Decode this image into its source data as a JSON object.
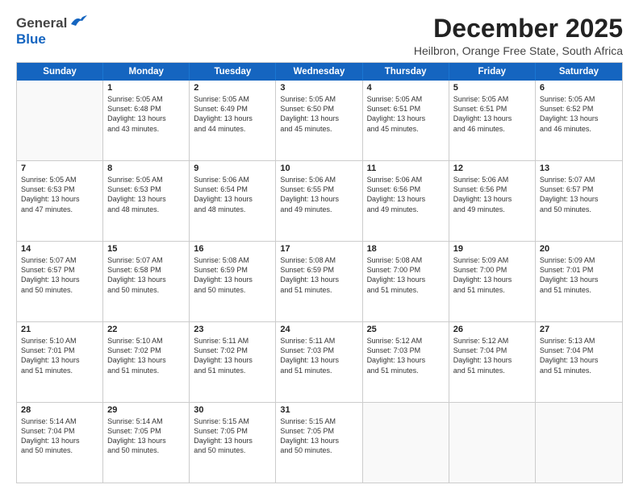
{
  "header": {
    "logo_general": "General",
    "logo_blue": "Blue",
    "month": "December 2025",
    "location": "Heilbron, Orange Free State, South Africa"
  },
  "weekdays": [
    "Sunday",
    "Monday",
    "Tuesday",
    "Wednesday",
    "Thursday",
    "Friday",
    "Saturday"
  ],
  "rows": [
    [
      {
        "day": "",
        "lines": []
      },
      {
        "day": "1",
        "lines": [
          "Sunrise: 5:05 AM",
          "Sunset: 6:48 PM",
          "Daylight: 13 hours",
          "and 43 minutes."
        ]
      },
      {
        "day": "2",
        "lines": [
          "Sunrise: 5:05 AM",
          "Sunset: 6:49 PM",
          "Daylight: 13 hours",
          "and 44 minutes."
        ]
      },
      {
        "day": "3",
        "lines": [
          "Sunrise: 5:05 AM",
          "Sunset: 6:50 PM",
          "Daylight: 13 hours",
          "and 45 minutes."
        ]
      },
      {
        "day": "4",
        "lines": [
          "Sunrise: 5:05 AM",
          "Sunset: 6:51 PM",
          "Daylight: 13 hours",
          "and 45 minutes."
        ]
      },
      {
        "day": "5",
        "lines": [
          "Sunrise: 5:05 AM",
          "Sunset: 6:51 PM",
          "Daylight: 13 hours",
          "and 46 minutes."
        ]
      },
      {
        "day": "6",
        "lines": [
          "Sunrise: 5:05 AM",
          "Sunset: 6:52 PM",
          "Daylight: 13 hours",
          "and 46 minutes."
        ]
      }
    ],
    [
      {
        "day": "7",
        "lines": [
          "Sunrise: 5:05 AM",
          "Sunset: 6:53 PM",
          "Daylight: 13 hours",
          "and 47 minutes."
        ]
      },
      {
        "day": "8",
        "lines": [
          "Sunrise: 5:05 AM",
          "Sunset: 6:53 PM",
          "Daylight: 13 hours",
          "and 48 minutes."
        ]
      },
      {
        "day": "9",
        "lines": [
          "Sunrise: 5:06 AM",
          "Sunset: 6:54 PM",
          "Daylight: 13 hours",
          "and 48 minutes."
        ]
      },
      {
        "day": "10",
        "lines": [
          "Sunrise: 5:06 AM",
          "Sunset: 6:55 PM",
          "Daylight: 13 hours",
          "and 49 minutes."
        ]
      },
      {
        "day": "11",
        "lines": [
          "Sunrise: 5:06 AM",
          "Sunset: 6:56 PM",
          "Daylight: 13 hours",
          "and 49 minutes."
        ]
      },
      {
        "day": "12",
        "lines": [
          "Sunrise: 5:06 AM",
          "Sunset: 6:56 PM",
          "Daylight: 13 hours",
          "and 49 minutes."
        ]
      },
      {
        "day": "13",
        "lines": [
          "Sunrise: 5:07 AM",
          "Sunset: 6:57 PM",
          "Daylight: 13 hours",
          "and 50 minutes."
        ]
      }
    ],
    [
      {
        "day": "14",
        "lines": [
          "Sunrise: 5:07 AM",
          "Sunset: 6:57 PM",
          "Daylight: 13 hours",
          "and 50 minutes."
        ]
      },
      {
        "day": "15",
        "lines": [
          "Sunrise: 5:07 AM",
          "Sunset: 6:58 PM",
          "Daylight: 13 hours",
          "and 50 minutes."
        ]
      },
      {
        "day": "16",
        "lines": [
          "Sunrise: 5:08 AM",
          "Sunset: 6:59 PM",
          "Daylight: 13 hours",
          "and 50 minutes."
        ]
      },
      {
        "day": "17",
        "lines": [
          "Sunrise: 5:08 AM",
          "Sunset: 6:59 PM",
          "Daylight: 13 hours",
          "and 51 minutes."
        ]
      },
      {
        "day": "18",
        "lines": [
          "Sunrise: 5:08 AM",
          "Sunset: 7:00 PM",
          "Daylight: 13 hours",
          "and 51 minutes."
        ]
      },
      {
        "day": "19",
        "lines": [
          "Sunrise: 5:09 AM",
          "Sunset: 7:00 PM",
          "Daylight: 13 hours",
          "and 51 minutes."
        ]
      },
      {
        "day": "20",
        "lines": [
          "Sunrise: 5:09 AM",
          "Sunset: 7:01 PM",
          "Daylight: 13 hours",
          "and 51 minutes."
        ]
      }
    ],
    [
      {
        "day": "21",
        "lines": [
          "Sunrise: 5:10 AM",
          "Sunset: 7:01 PM",
          "Daylight: 13 hours",
          "and 51 minutes."
        ]
      },
      {
        "day": "22",
        "lines": [
          "Sunrise: 5:10 AM",
          "Sunset: 7:02 PM",
          "Daylight: 13 hours",
          "and 51 minutes."
        ]
      },
      {
        "day": "23",
        "lines": [
          "Sunrise: 5:11 AM",
          "Sunset: 7:02 PM",
          "Daylight: 13 hours",
          "and 51 minutes."
        ]
      },
      {
        "day": "24",
        "lines": [
          "Sunrise: 5:11 AM",
          "Sunset: 7:03 PM",
          "Daylight: 13 hours",
          "and 51 minutes."
        ]
      },
      {
        "day": "25",
        "lines": [
          "Sunrise: 5:12 AM",
          "Sunset: 7:03 PM",
          "Daylight: 13 hours",
          "and 51 minutes."
        ]
      },
      {
        "day": "26",
        "lines": [
          "Sunrise: 5:12 AM",
          "Sunset: 7:04 PM",
          "Daylight: 13 hours",
          "and 51 minutes."
        ]
      },
      {
        "day": "27",
        "lines": [
          "Sunrise: 5:13 AM",
          "Sunset: 7:04 PM",
          "Daylight: 13 hours",
          "and 51 minutes."
        ]
      }
    ],
    [
      {
        "day": "28",
        "lines": [
          "Sunrise: 5:14 AM",
          "Sunset: 7:04 PM",
          "Daylight: 13 hours",
          "and 50 minutes."
        ]
      },
      {
        "day": "29",
        "lines": [
          "Sunrise: 5:14 AM",
          "Sunset: 7:05 PM",
          "Daylight: 13 hours",
          "and 50 minutes."
        ]
      },
      {
        "day": "30",
        "lines": [
          "Sunrise: 5:15 AM",
          "Sunset: 7:05 PM",
          "Daylight: 13 hours",
          "and 50 minutes."
        ]
      },
      {
        "day": "31",
        "lines": [
          "Sunrise: 5:15 AM",
          "Sunset: 7:05 PM",
          "Daylight: 13 hours",
          "and 50 minutes."
        ]
      },
      {
        "day": "",
        "lines": []
      },
      {
        "day": "",
        "lines": []
      },
      {
        "day": "",
        "lines": []
      }
    ]
  ]
}
